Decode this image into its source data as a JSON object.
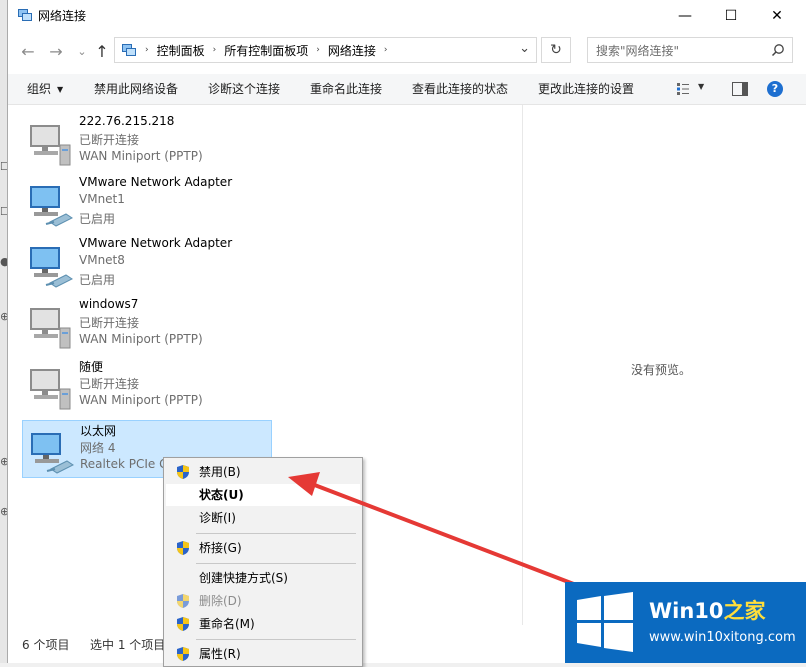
{
  "window": {
    "title": "网络连接",
    "controls": {
      "minimize": "—",
      "maximize": "☐",
      "close": "✕"
    }
  },
  "nav": {
    "back": "←",
    "forward": "→",
    "recent": "⌄",
    "up": "↑",
    "breadcrumb": [
      "控制面板",
      "所有控制面板项",
      "网络连接"
    ],
    "breadcrumb_sep": "›",
    "dropdown": "⌄",
    "refresh": "↻"
  },
  "search": {
    "placeholder": "搜索\"网络连接\""
  },
  "toolbar": {
    "organize": "组织",
    "disable_device": "禁用此网络设备",
    "diagnose": "诊断这个连接",
    "rename": "重命名此连接",
    "view_status": "查看此连接的状态",
    "change_settings": "更改此连接的设置",
    "help": "?"
  },
  "connections": [
    {
      "name": "222.76.215.218",
      "status": "已断开连接",
      "device": "WAN Miniport (PPTP)",
      "type": "wan"
    },
    {
      "name": "VMware Network Adapter",
      "status": "VMnet1",
      "device": "已启用",
      "type": "lan"
    },
    {
      "name": "VMware Network Adapter",
      "status": "VMnet8",
      "device": "已启用",
      "type": "lan"
    },
    {
      "name": "windows7",
      "status": "已断开连接",
      "device": "WAN Miniport (PPTP)",
      "type": "wan"
    },
    {
      "name": "随便",
      "status": "已断开连接",
      "device": "WAN Miniport (PPTP)",
      "type": "wan"
    },
    {
      "name": "以太网",
      "status": "网络 4",
      "device": "Realtek PCIe G",
      "type": "lan",
      "selected": true
    }
  ],
  "preview_text": "没有预览。",
  "statusbar": {
    "item_count": "6 个项目",
    "selected_count": "选中 1 个项目"
  },
  "context_menu": {
    "disable": "禁用(B)",
    "status": "状态(U)",
    "diagnose": "诊断(I)",
    "bridge": "桥接(G)",
    "shortcut": "创建快捷方式(S)",
    "delete": "删除(D)",
    "rename": "重命名(M)",
    "properties": "属性(R)"
  },
  "colors": {
    "accent": "#0078d7",
    "selection": "#cce8ff",
    "arrow": "#e53935",
    "watermark": "#0b6ac0"
  },
  "watermark": {
    "brand_prefix": "Win10",
    "brand_suffix": "之家",
    "url": "www.win10xitong.com"
  }
}
